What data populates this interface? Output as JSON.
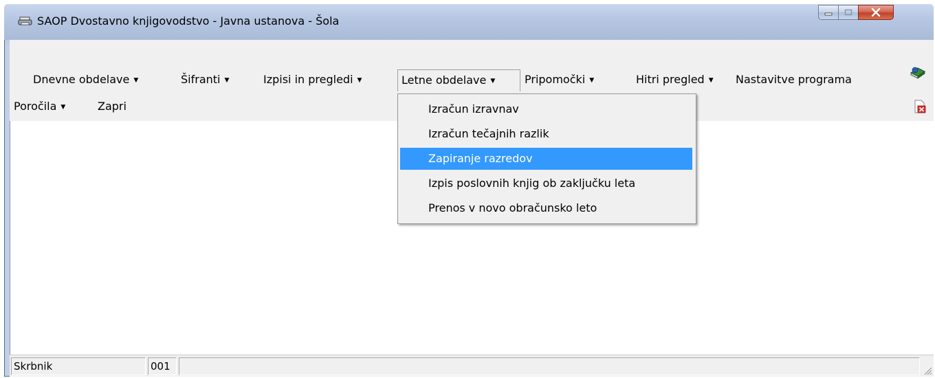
{
  "window": {
    "title": "SAOP Dvostavno knjigovodstvo  - Javna ustanova - Šola",
    "icon": "printer-icon",
    "controls": [
      "minimize-icon",
      "maximize-icon",
      "close-icon"
    ]
  },
  "menubar": {
    "row1": [
      {
        "label": "Dnevne obdelave",
        "has_caret": true
      },
      {
        "label": "Šifranti",
        "has_caret": true
      },
      {
        "label": "Izpisi in pregledi",
        "has_caret": true
      },
      {
        "label": "Letne obdelave",
        "has_caret": true,
        "open": true
      },
      {
        "label": "Pripomočki",
        "has_caret": true
      },
      {
        "label": "Hitri pregled",
        "has_caret": true
      },
      {
        "label": "Nastavitve programa",
        "has_caret": false
      }
    ],
    "row2": [
      {
        "label": "Poročila",
        "has_caret": true
      },
      {
        "label": "Zapri",
        "has_caret": false
      }
    ],
    "caret": "▼",
    "right_icons": [
      "book-go-icon",
      "close-document-icon"
    ]
  },
  "dropdown": {
    "items": [
      {
        "label": "Izračun izravnav",
        "highlighted": false
      },
      {
        "label": "Izračun tečajnih razlik",
        "highlighted": false
      },
      {
        "label": "Zapiranje razredov",
        "highlighted": true
      },
      {
        "label": "Izpis poslovnih knjig ob zaključku leta",
        "highlighted": false
      },
      {
        "label": "Prenos v novo obračunsko leto",
        "highlighted": false
      }
    ]
  },
  "statusbar": {
    "user": "Skrbnik",
    "code": "001",
    "empty": ""
  },
  "colors": {
    "highlight": "#3399ff",
    "menu_bg": "#f0f0f0",
    "titlebar": "#b5c6e2",
    "close_button": "#c0422b"
  }
}
